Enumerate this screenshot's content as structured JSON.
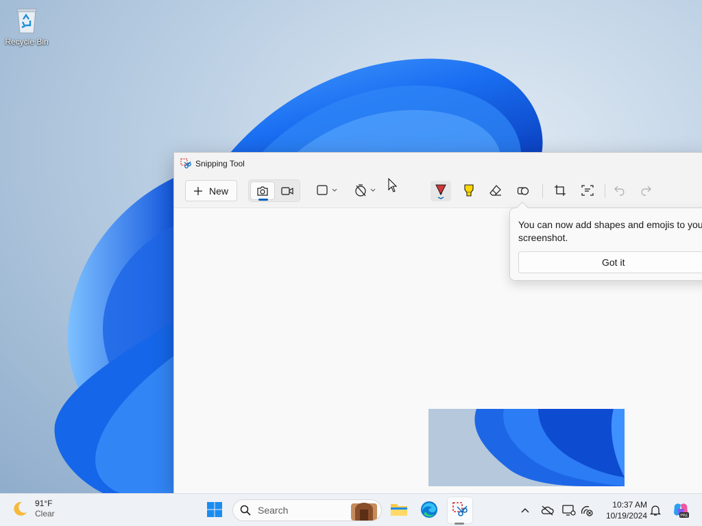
{
  "desktop": {
    "icons": [
      {
        "label": "Recycle Bin",
        "icon": "recycle-bin-icon"
      }
    ]
  },
  "window": {
    "title": "Snipping Tool",
    "app_icon": "scissors-icon",
    "toolbar": {
      "new_label": "New",
      "new_icon": "plus-icon",
      "modes": [
        "camera-icon",
        "video-icon"
      ],
      "active_mode": "camera-icon",
      "tools": [
        "snip-shape-icon",
        "delay-timer-icon",
        "pen-icon",
        "highlighter-icon",
        "eraser-icon",
        "shapes-icon",
        "crop-icon",
        "text-actions-icon",
        "undo-icon",
        "redo-icon"
      ],
      "pen_color": "#d13438",
      "highlighter_color": "#ffd700"
    }
  },
  "teaching_tip": {
    "message": "You can now add shapes and emojis to your screenshot.",
    "button_label": "Got it"
  },
  "taskbar": {
    "weather": {
      "temp": "91°F",
      "condition": "Clear",
      "icon": "moon-icon"
    },
    "search_placeholder": "Search",
    "apps": [
      "windows-start-icon",
      "search-icon",
      "file-explorer-icon",
      "edge-icon",
      "snipping-tool-icon"
    ],
    "tray": [
      "chevron-up-icon",
      "onedrive-icon",
      "display-icon",
      "network-icon",
      "notification-icon",
      "copilot-icon"
    ],
    "time": "10:37 AM",
    "date": "10/19/2024"
  },
  "colors": {
    "accent": "#005fb8",
    "wallpaper_blue": "#1f6fe0"
  }
}
